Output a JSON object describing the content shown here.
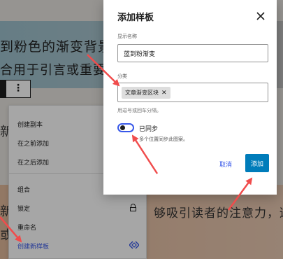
{
  "background": {
    "heading_line1": "到粉色的渐变背景示",
    "heading_line2": "合用于引言或重要提",
    "para_frag1": "新",
    "para_frag2": "新",
    "para_frag3": "或",
    "right_text": "够吸引读者的注意力，适"
  },
  "block_toolbar": {
    "more_icon": "⋮"
  },
  "context_menu": {
    "items": [
      {
        "label": "创建副本"
      },
      {
        "label": "在之前添加"
      },
      {
        "label": "在之后添加"
      },
      {
        "label": "组合"
      },
      {
        "label": "锁定",
        "icon": "lock-icon"
      },
      {
        "label": "重命名"
      },
      {
        "label": "创建新样板",
        "icon": "diamond-icon"
      }
    ]
  },
  "modal": {
    "title": "添加样板",
    "close_icon": "close-icon",
    "name_label": "显示名称",
    "name_value": "蓝到粉渐变",
    "category_label": "分类",
    "category_tag": "文章渐变区块",
    "category_help": "用逗号或回车分隔。",
    "sync_label": "已同步",
    "sync_help": "多个位置同步此图案。",
    "cancel_label": "取消",
    "add_label": "添加"
  },
  "colors": {
    "accent": "#3858e9",
    "primary_button": "#007cba",
    "annotation_arrow": "#f04c4c"
  }
}
